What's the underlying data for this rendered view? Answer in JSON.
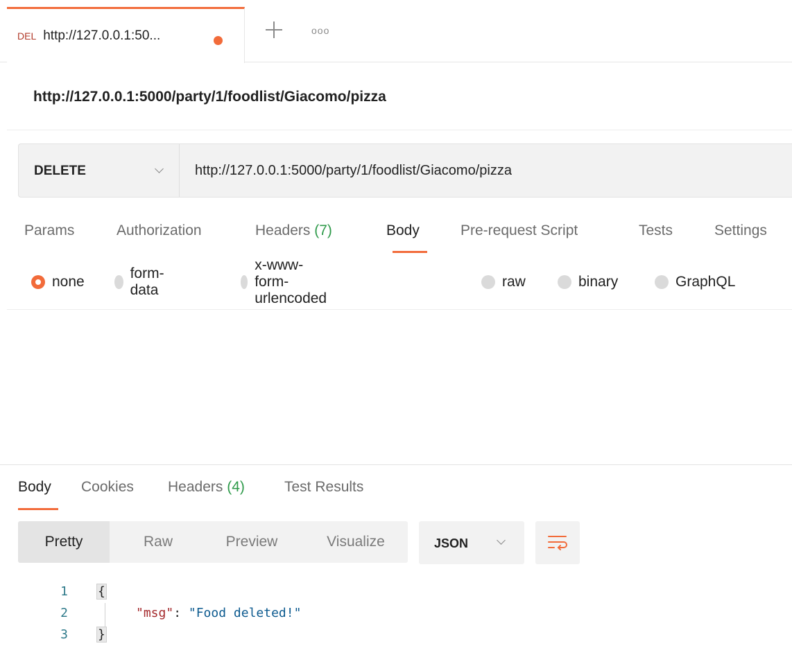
{
  "tab": {
    "method_badge": "DEL",
    "title": "http://127.0.0.1:50...",
    "unsaved_color": "#f26b3a",
    "add_icon": "plus-icon",
    "more_label": "ooo"
  },
  "request": {
    "title": "http://127.0.0.1:5000/party/1/foodlist/Giacomo/pizza",
    "method": "DELETE",
    "url": "http://127.0.0.1:5000/party/1/foodlist/Giacomo/pizza"
  },
  "request_tabs": [
    {
      "label": "Params"
    },
    {
      "label": "Authorization"
    },
    {
      "label": "Headers",
      "count": "(7)"
    },
    {
      "label": "Body",
      "active": true
    },
    {
      "label": "Pre-request Script"
    },
    {
      "label": "Tests"
    },
    {
      "label": "Settings"
    }
  ],
  "body_types": [
    {
      "label": "none",
      "selected": true
    },
    {
      "label": "form-data"
    },
    {
      "label": "x-www-form-urlencoded"
    },
    {
      "label": "raw"
    },
    {
      "label": "binary"
    },
    {
      "label": "GraphQL"
    }
  ],
  "response_tabs": [
    {
      "label": "Body",
      "active": true
    },
    {
      "label": "Cookies"
    },
    {
      "label": "Headers",
      "count": "(4)"
    },
    {
      "label": "Test Results"
    }
  ],
  "view_modes": [
    {
      "label": "Pretty",
      "active": true
    },
    {
      "label": "Raw"
    },
    {
      "label": "Preview"
    },
    {
      "label": "Visualize"
    }
  ],
  "format": "JSON",
  "wrap_icon": "wrap-lines-icon",
  "code_lines": [
    {
      "num": "1",
      "open": "{"
    },
    {
      "num": "2",
      "key": "\"msg\"",
      "sep": ": ",
      "value": "\"Food deleted!\""
    },
    {
      "num": "3",
      "close": "}"
    }
  ],
  "colors": {
    "accent": "#f26b3a",
    "count_green": "#2e9a4a",
    "json_key": "#a4282b",
    "json_string": "#0c5a8f"
  }
}
